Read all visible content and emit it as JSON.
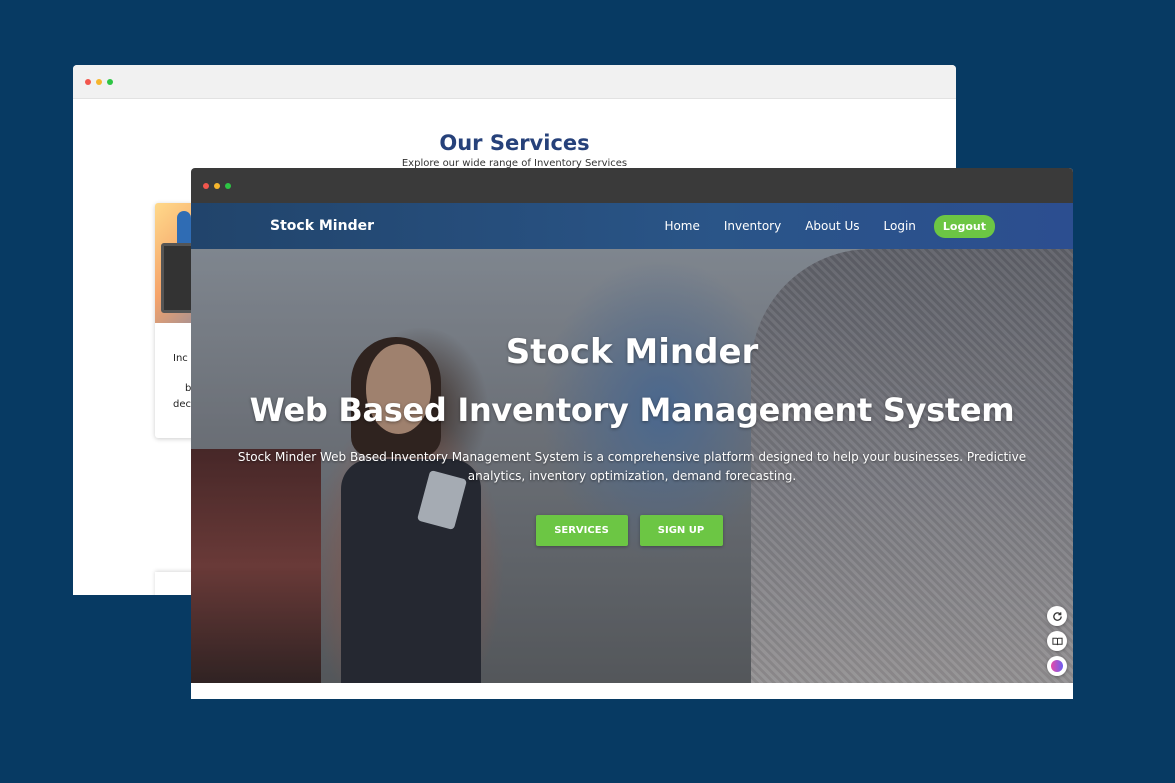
{
  "back_window": {
    "services_title": "Our Services",
    "services_subtitle": "Explore our wide range of Inventory Services",
    "card_fragments": [
      "Inc",
      "b",
      "dec"
    ]
  },
  "front_window": {
    "brand": "Stock Minder",
    "nav": {
      "home": "Home",
      "inventory": "Inventory",
      "about": "About Us",
      "login": "Login",
      "logout": "Logout"
    },
    "hero": {
      "title": "Stock Minder",
      "subtitle": "Web Based Inventory Management System",
      "description": "Stock Minder Web Based Inventory Management System is a comprehensive platform designed to help your businesses. Predictive analytics, inventory optimization, demand forecasting.",
      "services_button": "SERVICES",
      "signup_button": "SIGN UP"
    },
    "widgets": [
      "refresh-icon",
      "book-icon",
      "brain-icon"
    ]
  },
  "colors": {
    "background": "#073a63",
    "accent_green": "#6cc644",
    "navbar_blue": "#2a5588",
    "title_blue": "#26417a"
  }
}
